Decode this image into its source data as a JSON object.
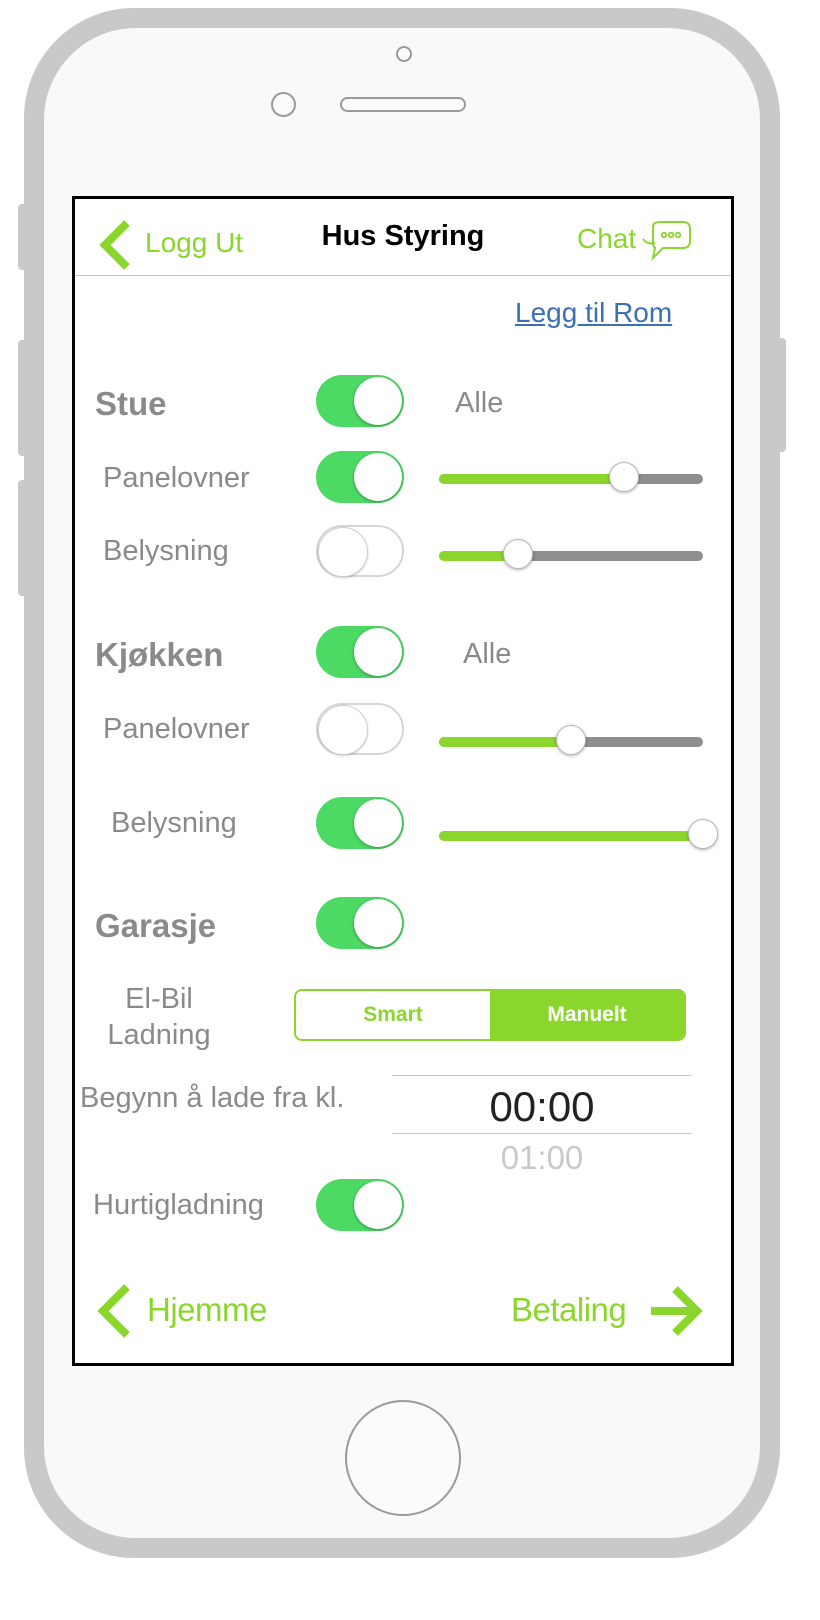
{
  "header": {
    "back_label": "Logg Ut",
    "title": "Hus Styring",
    "chat_label": "Chat"
  },
  "add_room_link": "Legg til Rom",
  "rooms": [
    {
      "name": "Stue",
      "on": true,
      "all_label": "Alle",
      "devices": [
        {
          "name": "Panelovner",
          "on": true,
          "level": 0.7
        },
        {
          "name": "Belysning",
          "on": false,
          "level": 0.3
        }
      ]
    },
    {
      "name": "Kjøkken",
      "on": true,
      "all_label": "Alle",
      "devices": [
        {
          "name": "Panelovner",
          "on": false,
          "level": 0.5
        },
        {
          "name": "Belysning",
          "on": true,
          "level": 1.0
        }
      ]
    },
    {
      "name": "Garasje",
      "on": true
    }
  ],
  "ev_charging": {
    "label_line1": "El-Bil",
    "label_line2": "Ladning",
    "modes": [
      "Smart",
      "Manuelt"
    ],
    "selected_mode": "Manuelt",
    "start_label": "Begynn å lade fra kl.",
    "picker_selected": "00:00",
    "picker_next": "01:00",
    "fast_charge_label": "Hurtigladning",
    "fast_charge_on": true
  },
  "footer": {
    "back_label": "Hjemme",
    "next_label": "Betaling"
  },
  "colors": {
    "accent": "#8bd62c",
    "toggle_on": "#4cd964",
    "link": "#3b6fb6",
    "muted_text": "#8a8a8a"
  }
}
